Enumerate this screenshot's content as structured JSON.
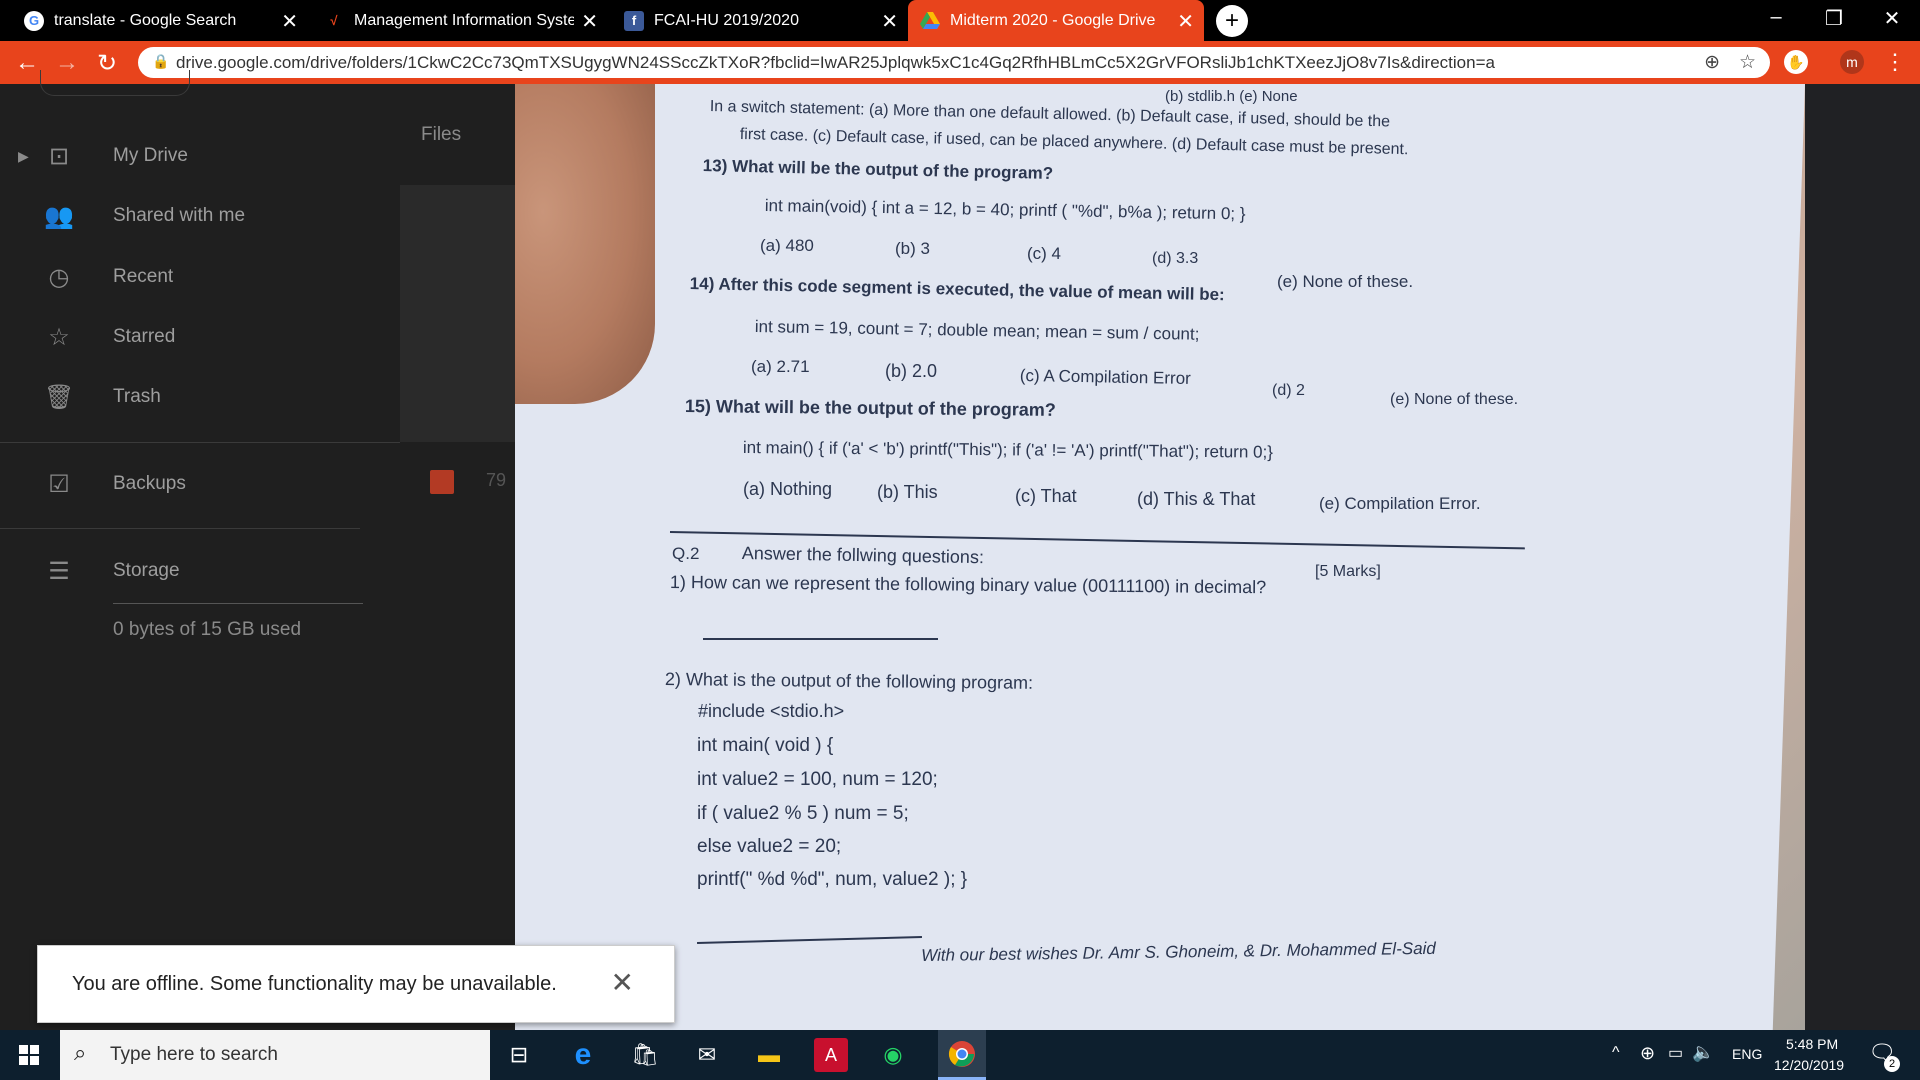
{
  "browser": {
    "tabs": [
      {
        "title": "translate - Google Search",
        "icon": "google-icon",
        "active": false
      },
      {
        "title": "Management Information Systen",
        "icon": "flame-icon",
        "active": false
      },
      {
        "title": "FCAI-HU 2019/2020",
        "icon": "facebook-icon",
        "active": false
      },
      {
        "title": "Midterm 2020 - Google Drive",
        "icon": "drive-icon",
        "active": true
      }
    ],
    "url": "drive.google.com/drive/folders/1CkwC2Cc73QmTXSUgygWN24SSccZkTXoR?fbclid=IwAR25Jplqwk5xC1c4Gq2RfhHBLmCc5X2GrVFORsliJb1chKTXeezJjO8v7Is&direction=a",
    "profile_initial": "m",
    "accent_color": "#e8441c"
  },
  "drive": {
    "files_label": "Files",
    "nav": [
      {
        "label": "My Drive",
        "icon": "drive-folder-icon"
      },
      {
        "label": "Shared with me",
        "icon": "people-icon"
      },
      {
        "label": "Recent",
        "icon": "clock-icon"
      },
      {
        "label": "Starred",
        "icon": "star-icon"
      },
      {
        "label": "Trash",
        "icon": "trash-icon"
      },
      {
        "label": "Backups",
        "icon": "backup-icon"
      },
      {
        "label": "Storage",
        "icon": "storage-icon"
      }
    ],
    "storage_text": "0 bytes of 15 GB used",
    "file_count_fragment": "79"
  },
  "exam": {
    "l0": "(b) stdlib.h     (e) None",
    "l1": "In a switch statement: (a) More than one default allowed. (b) Default case, if used, should be the",
    "l2": "first case. (c) Default case, if used, can be placed anywhere. (d) Default case must be present.",
    "q13": "13) What will be the output of the program?",
    "q13code": "int main(void) { int a = 12, b = 40; printf ( \"%d\", b%a ); return 0; }",
    "q13a": "(a) 480",
    "q13b": "(b) 3",
    "q13c": "(c) 4",
    "q13d": "(d) 3.3",
    "q13e": "(e) None of these.",
    "q14": "14) After this code segment is executed, the value of mean will be:",
    "q14code": "int sum = 19, count = 7; double mean; mean = sum / count;",
    "q14a": "(a) 2.71",
    "q14b": "(b) 2.0",
    "q14c": "(c) A Compilation Error",
    "q14d": "(d) 2",
    "q14e": "(e) None of these.",
    "q15": "15) What will be the output of the program?",
    "q15code": "int main() { if ('a' < 'b') printf(\"This\"); if ('a' != 'A') printf(\"That\"); return 0;}",
    "q15a": "(a) Nothing",
    "q15b": "(b) This",
    "q15c": "(c) That",
    "q15d": "(d) This & That",
    "q15e": "(e) Compilation Error.",
    "q2label": "Q.2",
    "q2title": "Answer the follwing questions:",
    "q2marks": "[5 Marks]",
    "q2_1": "1)  How can we represent the following binary value (00111100) in decimal?",
    "q2_2": "2)  What is the output of the following program:",
    "code1": "#include <stdio.h>",
    "code2": "int main( void ) {",
    "code3": "int value2 = 100, num = 120;",
    "code4": "if ( value2 % 5 ) num = 5;",
    "code5": "else value2 = 20;",
    "code6": "printf(\" %d %d\", num, value2 ); }",
    "footer": "With our best wishes   Dr. Amr S. Ghoneim, & Dr. Mohammed El-Said"
  },
  "toast": {
    "message": "You are offline. Some functionality may be unavailable."
  },
  "taskbar": {
    "search_placeholder": "Type here to search",
    "time": "5:48 PM",
    "date": "12/20/2019",
    "lang": "ENG",
    "notifications": "2"
  }
}
